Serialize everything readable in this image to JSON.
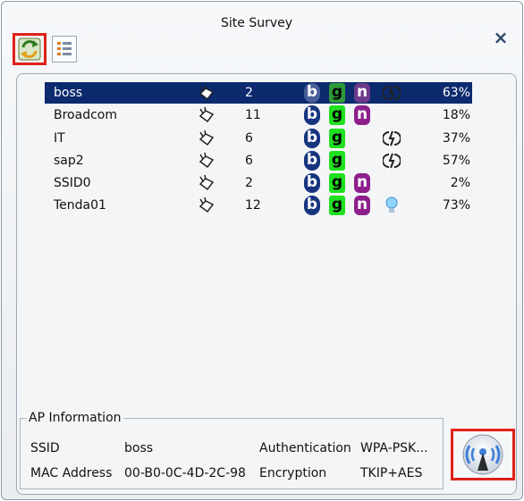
{
  "window": {
    "title": "Site Survey",
    "close_symbol": "×"
  },
  "toolbar": {
    "refresh_icon": "refresh-icon",
    "list_icon": "list-view-icon"
  },
  "networks": [
    {
      "ssid": "boss",
      "secured": true,
      "channel": "2",
      "b": true,
      "g": true,
      "n": true,
      "extra": "wps",
      "signal": "63%",
      "selected": true
    },
    {
      "ssid": "Broadcom",
      "secured": true,
      "channel": "11",
      "b": true,
      "g": true,
      "n": true,
      "extra": "",
      "signal": "18%",
      "selected": false
    },
    {
      "ssid": "IT",
      "secured": true,
      "channel": "6",
      "b": true,
      "g": true,
      "n": false,
      "extra": "wps",
      "signal": "37%",
      "selected": false
    },
    {
      "ssid": "sap2",
      "secured": true,
      "channel": "6",
      "b": true,
      "g": true,
      "n": false,
      "extra": "wps",
      "signal": "57%",
      "selected": false
    },
    {
      "ssid": "SSID0",
      "secured": true,
      "channel": "2",
      "b": true,
      "g": true,
      "n": true,
      "extra": "",
      "signal": "2%",
      "selected": false
    },
    {
      "ssid": "Tenda01",
      "secured": true,
      "channel": "12",
      "b": true,
      "g": true,
      "n": true,
      "extra": "bulb",
      "signal": "73%",
      "selected": false
    }
  ],
  "badges": {
    "b": "b",
    "g": "g",
    "n": "n"
  },
  "ap_info": {
    "legend": "AP Information",
    "ssid_label": "SSID",
    "ssid_value": "boss",
    "mac_label": "MAC Address",
    "mac_value": "00-B0-0C-4D-2C-98",
    "auth_label": "Authentication",
    "auth_value": "WPA-PSK...",
    "enc_label": "Encryption",
    "enc_value": "TKIP+AES"
  },
  "colors": {
    "selection": "#0c2a6e",
    "highlight_border": "#e0201a",
    "b_badge": "#17347f",
    "g_badge": "#1fe01f",
    "n_badge": "#8c1f8c"
  }
}
